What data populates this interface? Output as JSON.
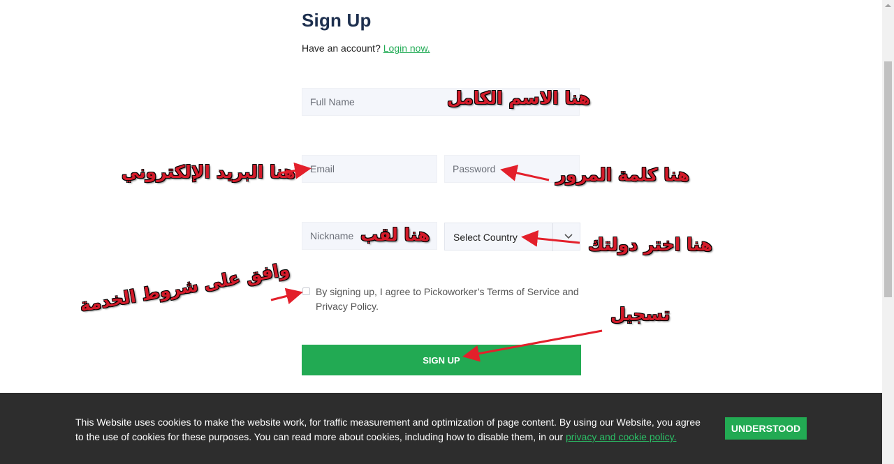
{
  "page": {
    "title": "Sign Up",
    "have_account": "Have an account?",
    "login_link": "Login now."
  },
  "form": {
    "fullname_placeholder": "Full Name",
    "email_placeholder": "Email",
    "password_placeholder": "Password",
    "nickname_placeholder": "Nickname",
    "country_select": "Select Country",
    "terms_text": "By signing up, I agree to Pickoworker’s Terms of Service and Privacy Policy.",
    "signup_label": "SIGN UP"
  },
  "annotations": {
    "fullname": "هنا الاسم الكامل",
    "email": "هنا البريد الإلكتروني",
    "password": "هنا كلمة المرور",
    "nickname": "هنا لقب",
    "country": "هنا اختر دولتك",
    "terms": "وافق على شروط الخدمة",
    "signup": "تسجيل"
  },
  "cookie": {
    "text": "This Website uses cookies to make the website work, for traffic measurement and optimization of page content. By using our Website, you agree to the use of cookies for these purposes. You can read more about cookies, including how to disable them, in our",
    "link": "privacy and cookie policy.",
    "button": "UNDERSTOOD"
  },
  "colors": {
    "accent": "#22aa53",
    "title": "#1d2f4e",
    "annotation": "#d31b2a",
    "cookie_bg": "#2d2d2d"
  },
  "icons": {
    "select_arrow": "chevron-down-icon"
  }
}
